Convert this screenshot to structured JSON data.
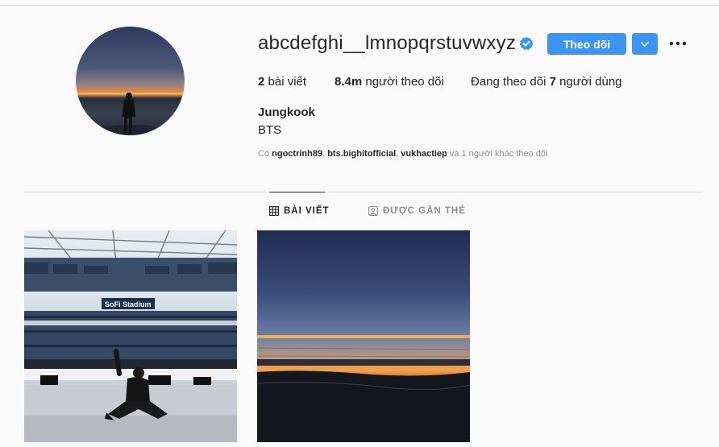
{
  "profile": {
    "username": "abcdefghi__lmnopqrstuvwxyz",
    "verified": true,
    "follow_label": "Theo dõi",
    "stats": {
      "posts_count": "2",
      "posts_label": "bài viết",
      "followers_count": "8.4m",
      "followers_label": "người theo dõi",
      "following_prefix": "Đang theo dõi",
      "following_count": "7",
      "following_label": "người dùng"
    },
    "full_name": "Jungkook",
    "bio": "BTS",
    "followed_by": {
      "prefix": "Có",
      "users": [
        "ngoctrinh89",
        "bts.bighitofficial",
        "vukhactiep"
      ],
      "suffix": "và 1 người khác theo dõi"
    }
  },
  "tabs": {
    "posts": "BÀI VIẾT",
    "tagged": "ĐƯỢC GẮN THẺ"
  },
  "posts": [
    {
      "sign_text": "SoFi Stadium"
    },
    {}
  ],
  "colors": {
    "accent": "#3d95ef",
    "verified": "#3897f0",
    "text": "#262626",
    "muted": "#8e8e8e",
    "background": "#fafafa"
  },
  "icons": {
    "verified": "verified-badge-icon",
    "dropdown": "chevron-down-icon",
    "more": "more-options-icon",
    "posts_tab": "grid-icon",
    "tagged_tab": "tagged-icon"
  }
}
